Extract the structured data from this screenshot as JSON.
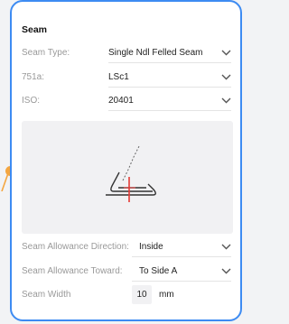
{
  "section_title": "Seam",
  "seam_type": {
    "label": "Seam Type:",
    "value": "Single Ndl Felled Seam"
  },
  "code_751a": {
    "label": "751a:",
    "value": "LSc1"
  },
  "iso": {
    "label": "ISO:",
    "value": "20401"
  },
  "diagram": {
    "icon": "felled-seam-diagram",
    "line_color": "#333333",
    "stitch_color": "#e53935"
  },
  "allowance_direction": {
    "label": "Seam Allowance Direction:",
    "value": "Inside"
  },
  "allowance_toward": {
    "label": "Seam Allowance Toward:",
    "value": "To Side A"
  },
  "seam_width": {
    "label": "Seam Width",
    "value": "10",
    "unit": "mm"
  },
  "colors": {
    "card_border": "#3d8bf2",
    "connector": "#f4a640"
  }
}
